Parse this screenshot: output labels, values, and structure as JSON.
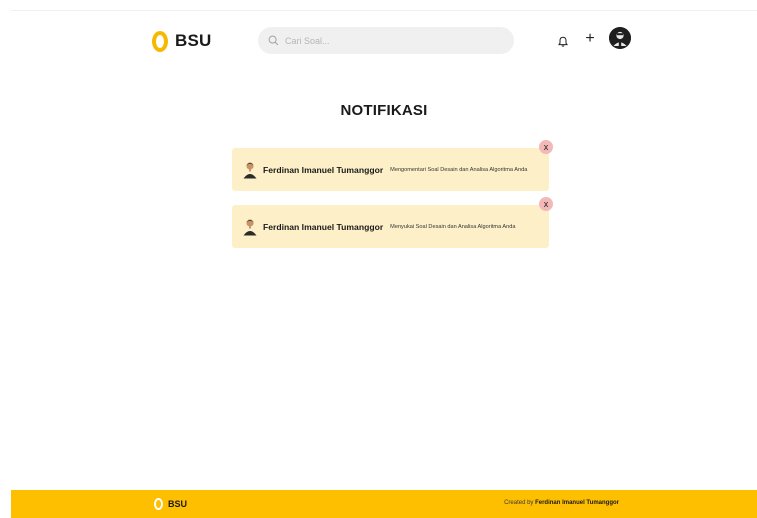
{
  "header": {
    "logo_text": "BSU",
    "search": {
      "placeholder": "Cari Soal...",
      "value": ""
    },
    "icons": [
      "search-icon",
      "bell-icon",
      "plus-icon",
      "user-avatar"
    ],
    "plus_label": "+"
  },
  "page": {
    "title": "NOTIFIKASI"
  },
  "notifications": [
    {
      "name": "Ferdinan Imanuel Tumanggor",
      "message": "Mengomentari Soal Desain dan Analisa Algoritma Anda",
      "close_label": "x"
    },
    {
      "name": "Ferdinan Imanuel Tumanggor",
      "message": "Menyukai Soal Desain dan Analisa Algoritma Anda",
      "close_label": "x"
    }
  ],
  "footer": {
    "logo_text": "BSU",
    "credit_prefix": "Created by ",
    "credit_name": "Ferdinan Imanuel Tumanggor"
  },
  "colors": {
    "accent": "#fdbf00",
    "notification_bg": "#fdf0c8",
    "close_bg": "#f3b9b9",
    "search_bg": "#f0f0f0"
  }
}
